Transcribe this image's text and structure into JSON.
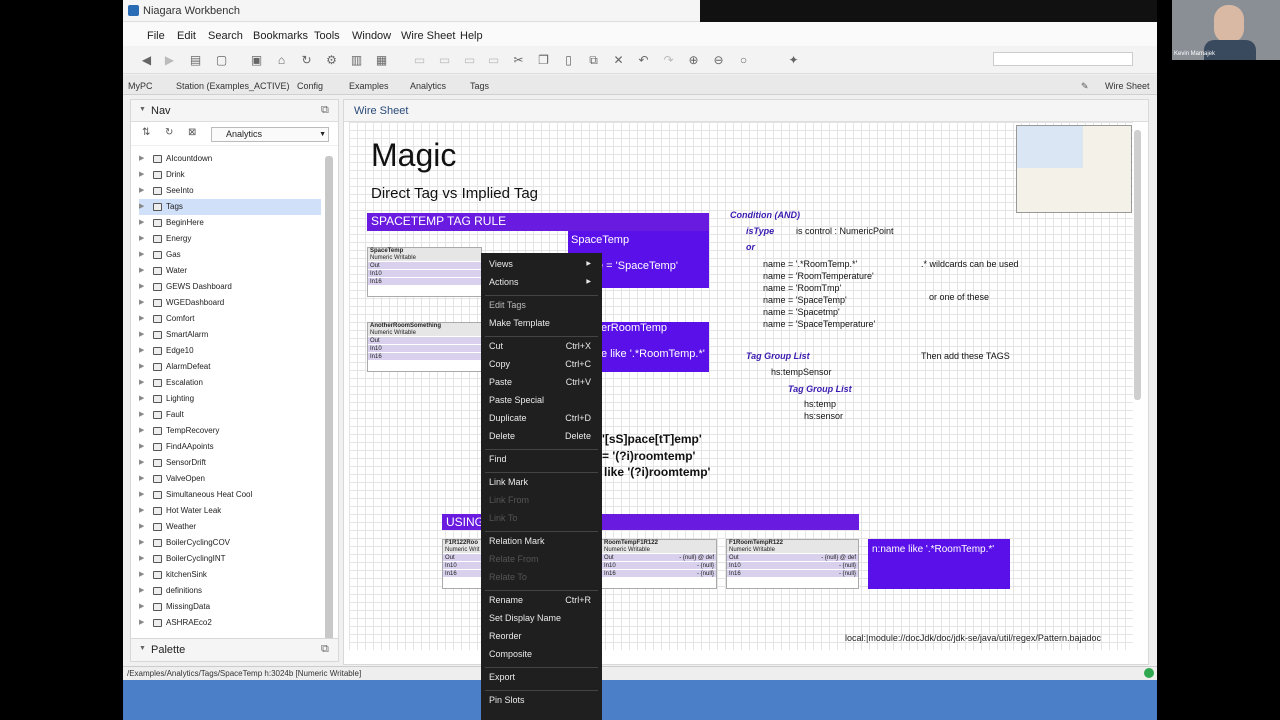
{
  "window": {
    "title": "Niagara Workbench"
  },
  "menus": [
    "File",
    "Edit",
    "Search",
    "Bookmarks",
    "Tools",
    "Window",
    "Wire Sheet",
    "Help"
  ],
  "breadcrumb": [
    "MyPC",
    "Station (Examples_ACTIVE)",
    "Config",
    "Examples",
    "Analytics",
    "Tags"
  ],
  "view_selector": "Wire Sheet",
  "nav": {
    "title": "Nav",
    "selector_value": "Analytics",
    "items": [
      "AIcountdown",
      "Drink",
      "SeeInto",
      "Tags",
      "BeginHere",
      "Energy",
      "Gas",
      "Water",
      "GEWS Dashboard",
      "WGEDashboard",
      "Comfort",
      "SmartAlarm",
      "Edge10",
      "AlarmDefeat",
      "Escalation",
      "Lighting",
      "Fault",
      "TempRecovery",
      "FindAApoints",
      "SensorDrift",
      "ValveOpen",
      "Simultaneous Heat Cool",
      "Hot Water Leak",
      "Weather",
      "BoilerCyclingCOV",
      "BoilerCyclingINT",
      "kitchenSink",
      "definitions",
      "MissingData",
      "ASHRAEco2"
    ],
    "selected_index": 3
  },
  "palette": {
    "title": "Palette"
  },
  "tab": {
    "title": "Wire Sheet"
  },
  "sheet": {
    "title": "Magic",
    "subtitle": "Direct Tag vs Implied Tag",
    "rule_banner": "SPACETEMP TAG RULE",
    "using_banner": "USING",
    "spacetemp_box": {
      "title": "SpaceTemp",
      "expr": "e = 'SpaceTemp'"
    },
    "roomtemp_box": {
      "title": "erRoomTemp",
      "expr": "e like '.*RoomTemp.*'"
    },
    "regex_lines": [
      "'[sS]pace[tT]emp'",
      "= '(?i)roomtemp'",
      "like '(?i)roomtemp'"
    ],
    "name_box": "n:name like '.*RoomTemp.*'",
    "components": [
      {
        "name": "SpaceTemp",
        "type": "Numeric Writable",
        "slots": [
          "Out",
          "In10",
          "In16"
        ]
      },
      {
        "name": "AnotherRoomSomething",
        "type": "Numeric Writable",
        "slots": [
          "Out",
          "In10",
          "In16"
        ]
      },
      {
        "name": "F1R122Roo",
        "type": "Numeric Writ",
        "slots": [
          "Out",
          "In10",
          "In16"
        ]
      },
      {
        "name": "RoomTempF1R122",
        "type": "Numeric Writable",
        "slots": [
          "Out",
          "In10",
          "In16"
        ],
        "values": [
          "- {null} @ def",
          "- {null}",
          "- {null}"
        ]
      },
      {
        "name": "F1RoomTempR122",
        "type": "Numeric Writable",
        "slots": [
          "Out",
          "In10",
          "In16"
        ],
        "values": [
          "- {null} @ def",
          "- {null}",
          "- {null}"
        ]
      }
    ],
    "condition": {
      "heading": "Condition (AND)",
      "istype_label": "isType",
      "istype_value": "is control : NumericPoint",
      "or_label": "or",
      "names": [
        "name = '.*RoomTemp.*'",
        "name = 'RoomTemperature'",
        "name = 'RoomTmp'",
        "name = 'SpaceTemp'",
        "name = 'Spacetmp'",
        "name = 'SpaceTemperature'"
      ],
      "wildcards_note": ".* wildcards can be used",
      "oneof_note": "or one of these"
    },
    "tag_group": {
      "label1": "Tag Group List",
      "value1": "hs:tempSensor",
      "label2": "Tag Group List",
      "values2": [
        "hs:temp",
        "hs:sensor"
      ],
      "note": "Then add these TAGS"
    },
    "footer_link": "local:|module://docJdk/doc/jdk-se/java/util/regex/Pattern.bajadoc"
  },
  "context_menu": {
    "items": [
      {
        "label": "Views",
        "submenu": true
      },
      {
        "label": "Actions",
        "submenu": true
      },
      {
        "sep": true
      },
      {
        "label": "Edit Tags",
        "state": "hover"
      },
      {
        "label": "Make Template"
      },
      {
        "sep": true
      },
      {
        "label": "Cut",
        "shortcut": "Ctrl+X"
      },
      {
        "label": "Copy",
        "shortcut": "Ctrl+C"
      },
      {
        "label": "Paste",
        "shortcut": "Ctrl+V"
      },
      {
        "label": "Paste Special"
      },
      {
        "label": "Duplicate",
        "shortcut": "Ctrl+D"
      },
      {
        "label": "Delete",
        "shortcut": "Delete"
      },
      {
        "sep": true
      },
      {
        "label": "Find"
      },
      {
        "sep": true
      },
      {
        "label": "Link Mark"
      },
      {
        "label": "Link From",
        "disabled": true
      },
      {
        "label": "Link To",
        "disabled": true
      },
      {
        "sep": true
      },
      {
        "label": "Relation Mark"
      },
      {
        "label": "Relate From",
        "disabled": true
      },
      {
        "label": "Relate To",
        "disabled": true
      },
      {
        "sep": true
      },
      {
        "label": "Rename",
        "shortcut": "Ctrl+R"
      },
      {
        "label": "Set Display Name"
      },
      {
        "label": "Reorder"
      },
      {
        "label": "Composite"
      },
      {
        "sep": true
      },
      {
        "label": "Export"
      },
      {
        "sep": true
      },
      {
        "label": "Pin Slots"
      }
    ]
  },
  "status": "/Examples/Analytics/Tags/SpaceTemp h:3024b [Numeric Writable]",
  "video": {
    "name": "Kevin Mamajek"
  }
}
